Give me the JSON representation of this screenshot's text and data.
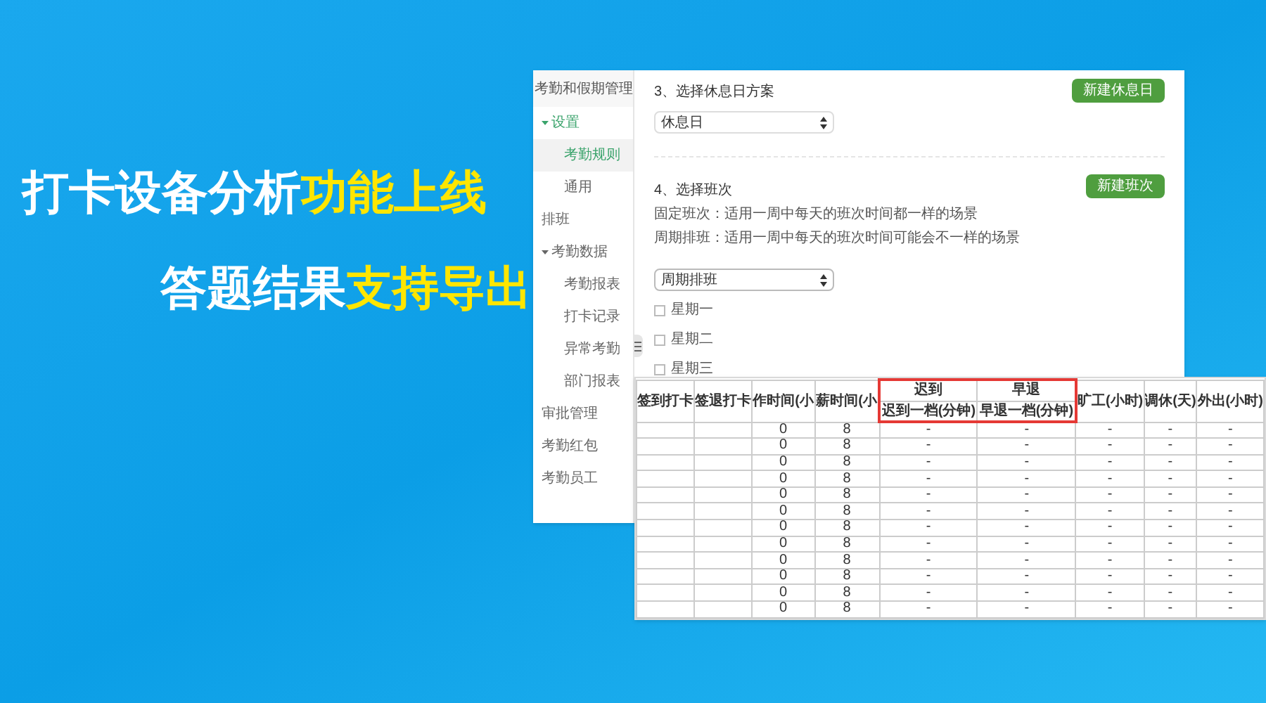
{
  "headline": [
    {
      "parts": [
        {
          "text": "打卡设备分析",
          "highlight": false
        },
        {
          "text": "功能上线",
          "highlight": true
        }
      ]
    },
    {
      "parts": [
        {
          "text": "答题结果",
          "highlight": false
        },
        {
          "text": "支持导出",
          "highlight": true
        }
      ]
    }
  ],
  "sidebar": {
    "title": "考勤和假期管理",
    "items": [
      {
        "label": "设置",
        "selected": false,
        "expanded": true,
        "children": [
          {
            "label": "考勤规则",
            "selected": true
          },
          {
            "label": "通用",
            "selected": false
          }
        ]
      },
      {
        "label": "排班",
        "selected": false
      },
      {
        "label": "考勤数据",
        "selected": false,
        "expanded": true,
        "children": [
          {
            "label": "考勤报表",
            "selected": false
          },
          {
            "label": "打卡记录",
            "selected": false
          },
          {
            "label": "异常考勤",
            "selected": false
          },
          {
            "label": "部门报表",
            "selected": false
          }
        ]
      },
      {
        "label": "审批管理",
        "selected": false
      },
      {
        "label": "考勤红包",
        "selected": false
      },
      {
        "label": "考勤员工",
        "selected": false
      }
    ]
  },
  "rest_section": {
    "title": "3、选择休息日方案",
    "button": "新建休息日",
    "select": "休息日"
  },
  "shift_section": {
    "title": "4、选择班次",
    "button": "新建班次",
    "descriptions": [
      "固定班次：适用一周中每天的班次时间都一样的场景",
      "周期排班：适用一周中每天的班次时间可能会不一样的场景"
    ],
    "select": "周期排班",
    "days": [
      {
        "label": "星期一",
        "checked": false
      },
      {
        "label": "星期二",
        "checked": false
      },
      {
        "label": "星期三",
        "checked": false
      }
    ]
  },
  "table": {
    "columns": [
      {
        "label": "签到打卡"
      },
      {
        "label": "签退打卡"
      },
      {
        "label": "作时间(小"
      },
      {
        "label": "薪时间(小"
      },
      {
        "label": "迟到",
        "sub": "迟到一档(分钟)",
        "highlight": true
      },
      {
        "label": "早退",
        "sub": "早退一档(分钟)",
        "highlight": true
      },
      {
        "label": "旷工(小时)"
      },
      {
        "label": "调休(天)"
      },
      {
        "label": "外出(小时)"
      }
    ],
    "rows": [
      [
        "",
        "",
        "0",
        "8",
        "-",
        "-",
        "-",
        "-",
        "-"
      ],
      [
        "",
        "",
        "0",
        "8",
        "-",
        "-",
        "-",
        "-",
        "-"
      ],
      [
        "",
        "",
        "0",
        "8",
        "-",
        "-",
        "-",
        "-",
        "-"
      ],
      [
        "",
        "",
        "0",
        "8",
        "-",
        "-",
        "-",
        "-",
        "-"
      ],
      [
        "",
        "",
        "0",
        "8",
        "-",
        "-",
        "-",
        "-",
        "-"
      ],
      [
        "",
        "",
        "0",
        "8",
        "-",
        "-",
        "-",
        "-",
        "-"
      ],
      [
        "",
        "",
        "0",
        "8",
        "-",
        "-",
        "-",
        "-",
        "-"
      ],
      [
        "",
        "",
        "0",
        "8",
        "-",
        "-",
        "-",
        "-",
        "-"
      ],
      [
        "",
        "",
        "0",
        "8",
        "-",
        "-",
        "-",
        "-",
        "-"
      ],
      [
        "",
        "",
        "0",
        "8",
        "-",
        "-",
        "-",
        "-",
        "-"
      ],
      [
        "",
        "",
        "0",
        "8",
        "-",
        "-",
        "-",
        "-",
        "-"
      ],
      [
        "",
        "",
        "0",
        "8",
        "-",
        "-",
        "-",
        "-",
        "-"
      ]
    ]
  }
}
